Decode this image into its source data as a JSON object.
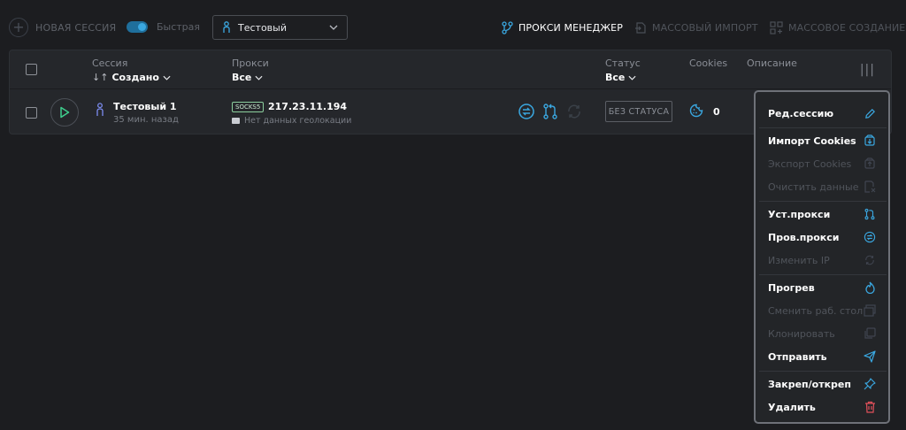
{
  "toolbar": {
    "new_session": "НОВАЯ СЕССИЯ",
    "quick_label": "Быстрая",
    "profile_select": "Тестовый",
    "proxy_manager": "ПРОКСИ МЕНЕДЖЕР",
    "mass_import": "МАССОВЫЙ ИМПОРТ",
    "mass_create": "МАССОВОЕ СОЗДАНИЕ"
  },
  "table": {
    "headers": {
      "session": "Сессия",
      "session_sort": "Создано",
      "proxy": "Прокси",
      "proxy_filter": "Все",
      "status": "Статус",
      "status_filter": "Все",
      "cookies": "Cookies",
      "description": "Описание"
    },
    "rows": [
      {
        "name": "Тестовый 1",
        "time": "35 мин. назад",
        "proxy_type": "SOCKS5",
        "proxy_ip": "217.23.11.194",
        "geo": "Нет данных геолокации",
        "status": "БЕЗ СТАТУСА",
        "cookies": "0"
      }
    ]
  },
  "menu": {
    "items": [
      {
        "label": "Ред.сессию",
        "enabled": true,
        "icon": "pencil-icon"
      },
      {
        "label": "Импорт Cookies",
        "enabled": true,
        "icon": "cookie-import-icon"
      },
      {
        "label": "Экспорт Cookies",
        "enabled": false,
        "icon": "cookie-export-icon"
      },
      {
        "label": "Очистить данные",
        "enabled": false,
        "icon": "clear-data-icon"
      },
      {
        "label": "Уст.прокси",
        "enabled": true,
        "icon": "proxy-set-icon"
      },
      {
        "label": "Пров.прокси",
        "enabled": true,
        "icon": "proxy-check-icon"
      },
      {
        "label": "Изменить IP",
        "enabled": false,
        "icon": "refresh-icon"
      },
      {
        "label": "Прогрев",
        "enabled": true,
        "icon": "flame-icon"
      },
      {
        "label": "Сменить раб. стол",
        "enabled": false,
        "icon": "desktop-icon"
      },
      {
        "label": "Клонировать",
        "enabled": false,
        "icon": "clone-icon"
      },
      {
        "label": "Отправить",
        "enabled": true,
        "icon": "send-icon"
      },
      {
        "label": "Закреп/откреп",
        "enabled": true,
        "icon": "pin-icon"
      },
      {
        "label": "Удалить",
        "enabled": true,
        "icon": "trash-icon"
      }
    ]
  },
  "colors": {
    "accent": "#3aa7e0",
    "play": "#3ecf8e",
    "danger": "#e0505a",
    "person": "#7c8cf0"
  }
}
